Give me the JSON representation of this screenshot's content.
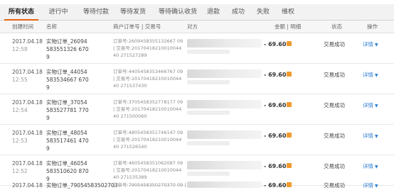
{
  "tabs": [
    "所有状态",
    "进行中",
    "等待付款",
    "等待发货",
    "等待确认收货",
    "退款",
    "成功",
    "失败",
    "维权"
  ],
  "header": {
    "created_time": "创建时间",
    "name": "名称",
    "order_no": "商户订单号 | 交易号",
    "party": "对方",
    "amount": "金额 | 明细",
    "status": "状态",
    "action": "操作"
  },
  "rows": [
    {
      "date": "2017.04.18",
      "time": "12:58",
      "name": "实物订单_26094583551326 6709",
      "orders": "订单号:2609458355132667 09 | 交易号:2017041821001004440 271527289",
      "amount": "- 69.60",
      "status": "交易成功",
      "detail": "详情"
    },
    {
      "date": "2017.04.18",
      "time": "12:55",
      "name": "实物订单_44054583534667 6709",
      "orders": "订单号:4405458353466767 09 | 交易号:2017041821001004440 271537430",
      "amount": "- 69.60",
      "status": "交易成功",
      "detail": "详情"
    },
    {
      "date": "2017.04.18",
      "time": "12:54",
      "name": "实物订单_37054583527781 7709",
      "orders": "订单号:3705458352778177 09 | 交易号:2017041821001004440 271500060",
      "amount": "- 69.60",
      "status": "交易成功",
      "detail": "详情"
    },
    {
      "date": "2017.04.18",
      "time": "12:53",
      "name": "实物订单_48054583517461 4709",
      "orders": "订单号:4805458351746147 09 | 交易号:2017041821001004440 271526540",
      "amount": "- 69.60",
      "status": "交易成功",
      "detail": "详情"
    },
    {
      "date": "2017.04.18",
      "time": "12:52",
      "name": "实物订单_46054583510620 8709",
      "orders": "订单号:4605458351062087 09 | 交易号:2017041821001004440 271535389",
      "amount": "- 69.60",
      "status": "交易成功",
      "detail": "详情"
    },
    {
      "date": "2017.04.18",
      "time": "",
      "name": "实物订单_79054583502703",
      "orders": "订单号:7905458350270370 09 |",
      "amount": "- 69.60",
      "status": "交易成功",
      "detail": "详情"
    }
  ]
}
